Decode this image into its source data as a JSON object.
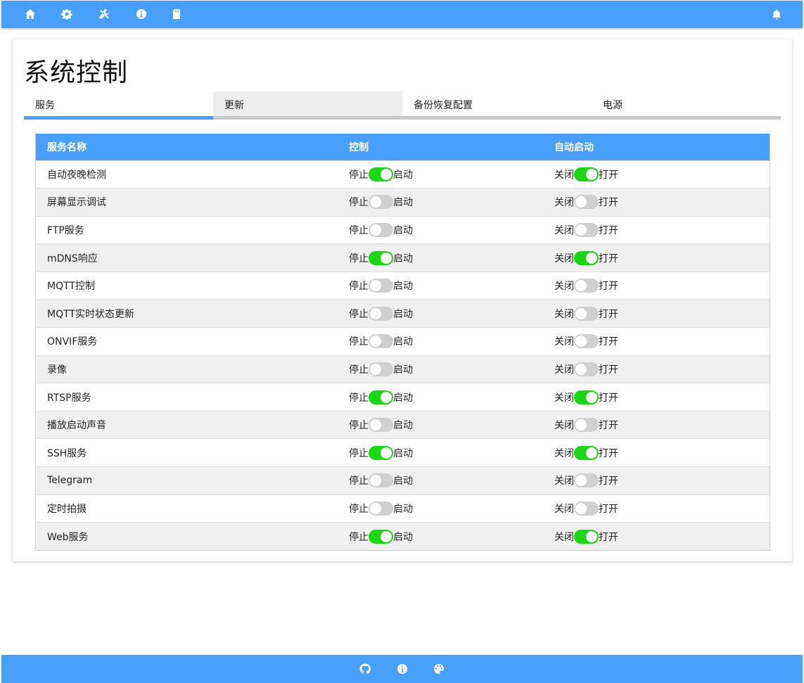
{
  "nav": {
    "icons": [
      "home-icon",
      "gear-icon",
      "tools-icon",
      "info-icon",
      "sd-card-icon",
      "bell-icon"
    ]
  },
  "page": {
    "title": "系统控制"
  },
  "tabs": [
    "服务",
    "更新",
    "备份恢复配置",
    "电源"
  ],
  "table": {
    "headers": {
      "name": "服务名称",
      "control": "控制",
      "autostart": "自动启动"
    },
    "control_labels": {
      "off": "停止",
      "on": "启动"
    },
    "autostart_labels": {
      "off": "关闭",
      "on": "打开"
    },
    "rows": [
      {
        "name": "自动夜晚检测",
        "running": true,
        "autostart": true
      },
      {
        "name": "屏幕显示调试",
        "running": false,
        "autostart": false
      },
      {
        "name": "FTP服务",
        "running": false,
        "autostart": false
      },
      {
        "name": "mDNS响应",
        "running": true,
        "autostart": true
      },
      {
        "name": "MQTT控制",
        "running": false,
        "autostart": false
      },
      {
        "name": "MQTT实时状态更新",
        "running": false,
        "autostart": false
      },
      {
        "name": "ONVIF服务",
        "running": false,
        "autostart": false
      },
      {
        "name": "录像",
        "running": false,
        "autostart": false
      },
      {
        "name": "RTSP服务",
        "running": true,
        "autostart": true
      },
      {
        "name": "播放启动声音",
        "running": false,
        "autostart": false
      },
      {
        "name": "SSH服务",
        "running": true,
        "autostart": true
      },
      {
        "name": "Telegram",
        "running": false,
        "autostart": false
      },
      {
        "name": "定时拍摄",
        "running": false,
        "autostart": false
      },
      {
        "name": "Web服务",
        "running": true,
        "autostart": true
      }
    ]
  },
  "footer": {
    "icons": [
      "github-icon",
      "info-icon",
      "palette-icon"
    ]
  },
  "colors": {
    "accent": "#48a0fc",
    "toggle_on": "#18d814",
    "toggle_off": "#d0d0d0"
  }
}
